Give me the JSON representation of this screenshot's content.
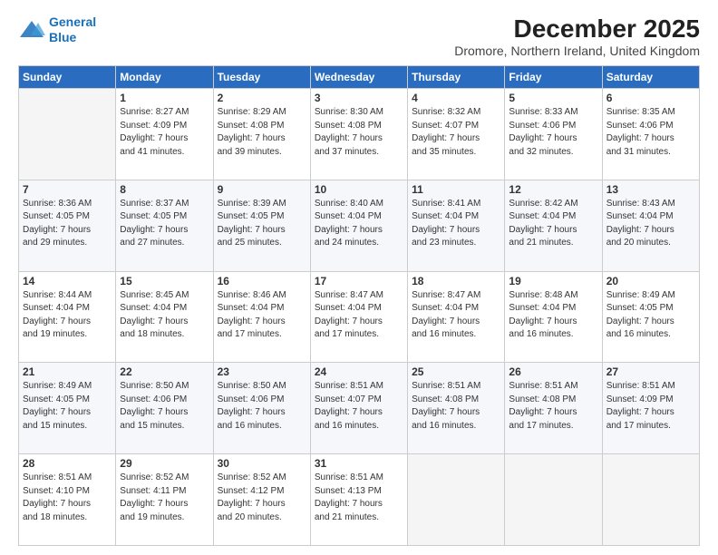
{
  "logo": {
    "line1": "General",
    "line2": "Blue"
  },
  "header": {
    "title": "December 2025",
    "subtitle": "Dromore, Northern Ireland, United Kingdom"
  },
  "weekdays": [
    "Sunday",
    "Monday",
    "Tuesday",
    "Wednesday",
    "Thursday",
    "Friday",
    "Saturday"
  ],
  "weeks": [
    [
      {
        "day": "",
        "info": ""
      },
      {
        "day": "1",
        "info": "Sunrise: 8:27 AM\nSunset: 4:09 PM\nDaylight: 7 hours\nand 41 minutes."
      },
      {
        "day": "2",
        "info": "Sunrise: 8:29 AM\nSunset: 4:08 PM\nDaylight: 7 hours\nand 39 minutes."
      },
      {
        "day": "3",
        "info": "Sunrise: 8:30 AM\nSunset: 4:08 PM\nDaylight: 7 hours\nand 37 minutes."
      },
      {
        "day": "4",
        "info": "Sunrise: 8:32 AM\nSunset: 4:07 PM\nDaylight: 7 hours\nand 35 minutes."
      },
      {
        "day": "5",
        "info": "Sunrise: 8:33 AM\nSunset: 4:06 PM\nDaylight: 7 hours\nand 32 minutes."
      },
      {
        "day": "6",
        "info": "Sunrise: 8:35 AM\nSunset: 4:06 PM\nDaylight: 7 hours\nand 31 minutes."
      }
    ],
    [
      {
        "day": "7",
        "info": "Sunrise: 8:36 AM\nSunset: 4:05 PM\nDaylight: 7 hours\nand 29 minutes."
      },
      {
        "day": "8",
        "info": "Sunrise: 8:37 AM\nSunset: 4:05 PM\nDaylight: 7 hours\nand 27 minutes."
      },
      {
        "day": "9",
        "info": "Sunrise: 8:39 AM\nSunset: 4:05 PM\nDaylight: 7 hours\nand 25 minutes."
      },
      {
        "day": "10",
        "info": "Sunrise: 8:40 AM\nSunset: 4:04 PM\nDaylight: 7 hours\nand 24 minutes."
      },
      {
        "day": "11",
        "info": "Sunrise: 8:41 AM\nSunset: 4:04 PM\nDaylight: 7 hours\nand 23 minutes."
      },
      {
        "day": "12",
        "info": "Sunrise: 8:42 AM\nSunset: 4:04 PM\nDaylight: 7 hours\nand 21 minutes."
      },
      {
        "day": "13",
        "info": "Sunrise: 8:43 AM\nSunset: 4:04 PM\nDaylight: 7 hours\nand 20 minutes."
      }
    ],
    [
      {
        "day": "14",
        "info": "Sunrise: 8:44 AM\nSunset: 4:04 PM\nDaylight: 7 hours\nand 19 minutes."
      },
      {
        "day": "15",
        "info": "Sunrise: 8:45 AM\nSunset: 4:04 PM\nDaylight: 7 hours\nand 18 minutes."
      },
      {
        "day": "16",
        "info": "Sunrise: 8:46 AM\nSunset: 4:04 PM\nDaylight: 7 hours\nand 17 minutes."
      },
      {
        "day": "17",
        "info": "Sunrise: 8:47 AM\nSunset: 4:04 PM\nDaylight: 7 hours\nand 17 minutes."
      },
      {
        "day": "18",
        "info": "Sunrise: 8:47 AM\nSunset: 4:04 PM\nDaylight: 7 hours\nand 16 minutes."
      },
      {
        "day": "19",
        "info": "Sunrise: 8:48 AM\nSunset: 4:04 PM\nDaylight: 7 hours\nand 16 minutes."
      },
      {
        "day": "20",
        "info": "Sunrise: 8:49 AM\nSunset: 4:05 PM\nDaylight: 7 hours\nand 16 minutes."
      }
    ],
    [
      {
        "day": "21",
        "info": "Sunrise: 8:49 AM\nSunset: 4:05 PM\nDaylight: 7 hours\nand 15 minutes."
      },
      {
        "day": "22",
        "info": "Sunrise: 8:50 AM\nSunset: 4:06 PM\nDaylight: 7 hours\nand 15 minutes."
      },
      {
        "day": "23",
        "info": "Sunrise: 8:50 AM\nSunset: 4:06 PM\nDaylight: 7 hours\nand 16 minutes."
      },
      {
        "day": "24",
        "info": "Sunrise: 8:51 AM\nSunset: 4:07 PM\nDaylight: 7 hours\nand 16 minutes."
      },
      {
        "day": "25",
        "info": "Sunrise: 8:51 AM\nSunset: 4:08 PM\nDaylight: 7 hours\nand 16 minutes."
      },
      {
        "day": "26",
        "info": "Sunrise: 8:51 AM\nSunset: 4:08 PM\nDaylight: 7 hours\nand 17 minutes."
      },
      {
        "day": "27",
        "info": "Sunrise: 8:51 AM\nSunset: 4:09 PM\nDaylight: 7 hours\nand 17 minutes."
      }
    ],
    [
      {
        "day": "28",
        "info": "Sunrise: 8:51 AM\nSunset: 4:10 PM\nDaylight: 7 hours\nand 18 minutes."
      },
      {
        "day": "29",
        "info": "Sunrise: 8:52 AM\nSunset: 4:11 PM\nDaylight: 7 hours\nand 19 minutes."
      },
      {
        "day": "30",
        "info": "Sunrise: 8:52 AM\nSunset: 4:12 PM\nDaylight: 7 hours\nand 20 minutes."
      },
      {
        "day": "31",
        "info": "Sunrise: 8:51 AM\nSunset: 4:13 PM\nDaylight: 7 hours\nand 21 minutes."
      },
      {
        "day": "",
        "info": ""
      },
      {
        "day": "",
        "info": ""
      },
      {
        "day": "",
        "info": ""
      }
    ]
  ]
}
